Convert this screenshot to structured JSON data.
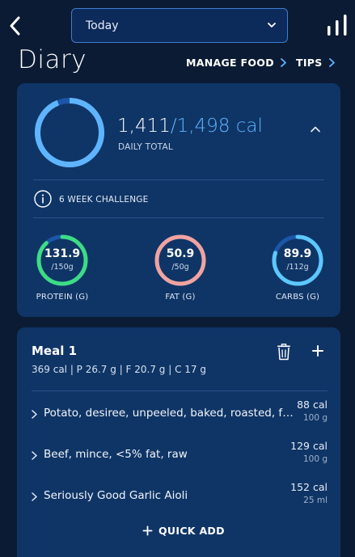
{
  "header": {
    "date_value": "Today",
    "title": "Diary",
    "manage_food_label": "MANAGE FOOD",
    "tips_label": "TIPS"
  },
  "summary": {
    "consumed": "1,411",
    "target": "/1,498 cal",
    "label": "DAILY TOTAL",
    "progress": 0.94,
    "challenge_label": "6 WEEK CHALLENGE",
    "macros": [
      {
        "value": "131.9",
        "target": "/150g",
        "label": "PROTEIN (G)",
        "progress": 0.88,
        "color": "#3ddc84"
      },
      {
        "value": "50.9",
        "target": "/50g",
        "label": "FAT (G)",
        "progress": 1.0,
        "color": "#f0a3a0"
      },
      {
        "value": "89.9",
        "target": "/112g",
        "label": "CARBS (G)",
        "progress": 0.8,
        "color": "#5cc8ff"
      }
    ]
  },
  "meal": {
    "title": "Meal 1",
    "summary": "369 cal | P 26.7 g | F 20.7 g | C 17 g",
    "items": [
      {
        "name": "Potato, desiree, unpeeled, baked, roasted, fr...",
        "cal": "88 cal",
        "amount": "100 g"
      },
      {
        "name": "Beef, mince, <5% fat, raw",
        "cal": "129 cal",
        "amount": "100 g"
      },
      {
        "name": "Seriously Good Garlic Aioli",
        "cal": "152 cal",
        "amount": "25 ml"
      }
    ],
    "quick_add_label": "QUICK ADD"
  },
  "colors": {
    "background": "#0b1b34",
    "card": "#0f3566",
    "accent": "#5fb4ff",
    "ring_track": "#1b56a8"
  }
}
